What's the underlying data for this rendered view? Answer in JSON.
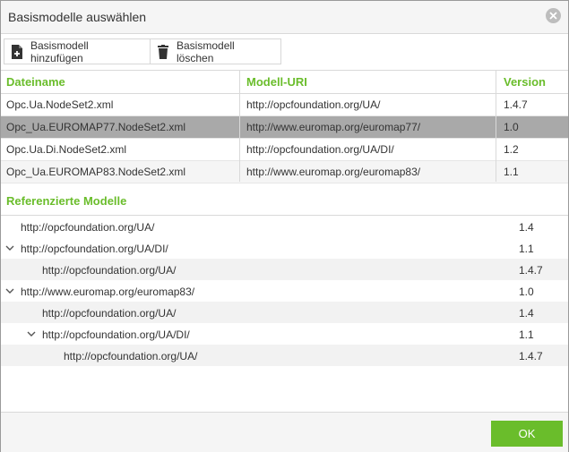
{
  "dialog": {
    "title": "Basismodelle auswählen",
    "close_icon": "close-icon"
  },
  "toolbar": {
    "add_label": "Basismodell hinzufügen",
    "add_icon": "add-file-icon",
    "delete_label": "Basismodell löschen",
    "delete_icon": "trash-icon"
  },
  "table": {
    "headers": [
      "Dateiname",
      "Modell-URI",
      "Version"
    ],
    "rows": [
      {
        "file": "Opc.Ua.NodeSet2.xml",
        "uri": "http://opcfoundation.org/UA/",
        "version": "1.4.7",
        "selected": false
      },
      {
        "file": "Opc_Ua.EUROMAP77.NodeSet2.xml",
        "uri": "http://www.euromap.org/euromap77/",
        "version": "1.0",
        "selected": true
      },
      {
        "file": "Opc.Ua.Di.NodeSet2.xml",
        "uri": "http://opcfoundation.org/UA/DI/",
        "version": "1.2",
        "selected": false
      },
      {
        "file": "Opc_Ua.EUROMAP83.NodeSet2.xml",
        "uri": "http://www.euromap.org/euromap83/",
        "version": "1.1",
        "selected": false
      }
    ]
  },
  "references": {
    "title": "Referenzierte Modelle",
    "items": [
      {
        "uri": "http://opcfoundation.org/UA/",
        "version": "1.4",
        "level": 0,
        "expanded": false
      },
      {
        "uri": "http://opcfoundation.org/UA/DI/",
        "version": "1.1",
        "level": 0,
        "expanded": true
      },
      {
        "uri": "http://opcfoundation.org/UA/",
        "version": "1.4.7",
        "level": 1,
        "expanded": false
      },
      {
        "uri": "http://www.euromap.org/euromap83/",
        "version": "1.0",
        "level": 0,
        "expanded": true
      },
      {
        "uri": "http://opcfoundation.org/UA/",
        "version": "1.4",
        "level": 1,
        "expanded": false
      },
      {
        "uri": "http://opcfoundation.org/UA/DI/",
        "version": "1.1",
        "level": 1,
        "expanded": true
      },
      {
        "uri": "http://opcfoundation.org/UA/",
        "version": "1.4.7",
        "level": 2,
        "expanded": false
      }
    ]
  },
  "footer": {
    "ok_label": "OK"
  },
  "colors": {
    "accent": "#6abd2b",
    "selected_row": "#a9a9a9"
  }
}
